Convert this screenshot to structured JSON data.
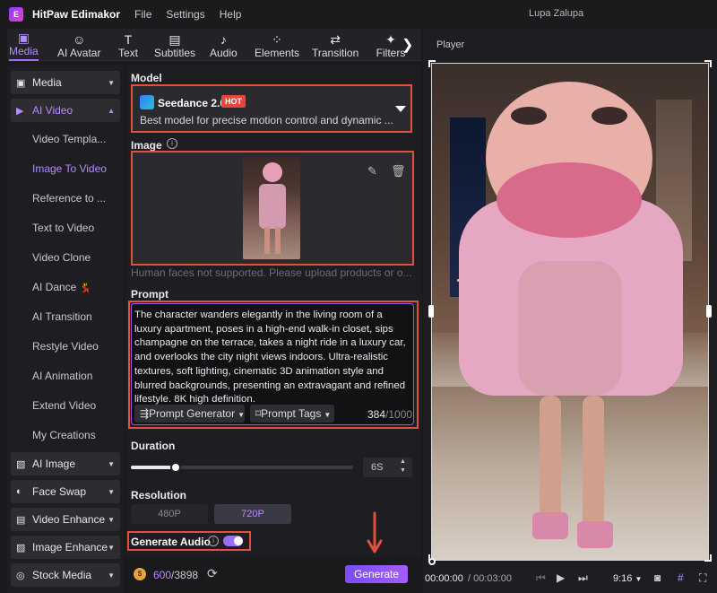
{
  "app": {
    "name": "HitPaw Edimakor",
    "logo": "E",
    "window_title": "Lupa Zalupa",
    "menu": [
      "File",
      "Settings",
      "Help"
    ]
  },
  "toolbar": {
    "tabs": [
      {
        "label": "Media",
        "icon": "media-icon",
        "glyph": "▣",
        "active": true
      },
      {
        "label": "AI Avatar",
        "icon": "ai-avatar-icon",
        "glyph": "☺"
      },
      {
        "label": "Text",
        "icon": "text-icon",
        "glyph": "T"
      },
      {
        "label": "Subtitles",
        "icon": "subtitles-icon",
        "glyph": "▤"
      },
      {
        "label": "Audio",
        "icon": "audio-icon",
        "glyph": "♪"
      },
      {
        "label": "Elements",
        "icon": "elements-icon",
        "glyph": "⁘"
      },
      {
        "label": "Transition",
        "icon": "transition-icon",
        "glyph": "⇄"
      },
      {
        "label": "Filters",
        "icon": "filters-icon",
        "glyph": "✦"
      }
    ],
    "next_glyph": "❯"
  },
  "sidebar": {
    "groups": [
      {
        "label": "Media",
        "glyph": "▣",
        "icon": "media-icon"
      },
      {
        "label": "AI Video",
        "glyph": "▶",
        "icon": "ai-video-icon",
        "active": true,
        "expanded": true
      },
      {
        "label": "AI Image",
        "glyph": "▧",
        "icon": "ai-image-icon"
      },
      {
        "label": "Face Swap",
        "glyph": "◐",
        "icon": "face-swap-icon"
      },
      {
        "label": "Video Enhance",
        "glyph": "▤",
        "icon": "video-enhance-icon"
      },
      {
        "label": "Image Enhance",
        "glyph": "▨",
        "icon": "image-enhance-icon"
      },
      {
        "label": "Stock Media",
        "glyph": "◎",
        "icon": "stock-media-icon"
      }
    ],
    "ai_video_items": [
      "Video Templa...",
      "Image To Video",
      "Reference to ...",
      "Text to Video",
      "Video Clone",
      "AI Dance",
      "AI Transition",
      "Restyle Video",
      "AI Animation",
      "Extend Video",
      "My Creations"
    ],
    "active_item": "Image To Video",
    "ai_dance_emoji": "💃"
  },
  "model": {
    "section_label": "Model",
    "name": "Seedance 2.0",
    "badge": "HOT",
    "description": "Best model for precise motion control and dynamic ..."
  },
  "image": {
    "section_label": "Image",
    "info_glyph": "i",
    "edit_glyph": "✎",
    "delete_glyph": "🗑",
    "hint": "Human faces not supported. Please upload products or o..."
  },
  "prompt": {
    "section_label": "Prompt",
    "text": "The character wanders elegantly in the living room of a luxury apartment, poses in a high-end walk-in closet, sips champagne on the terrace, takes a night ride in a luxury car, and overlooks the city night views indoors. Ultra-realistic textures, soft lighting, cinematic 3D animation style and blurred backgrounds, presenting an extravagant and refined lifestyle. 8K high definition.",
    "generator_label": "Prompt Generator",
    "tags_label": "Prompt Tags",
    "char_count": "384",
    "char_max": "/1000"
  },
  "duration": {
    "section_label": "Duration",
    "value": "6S",
    "slider_fraction": 0.2
  },
  "resolution": {
    "section_label": "Resolution",
    "options": [
      "480P",
      "720P"
    ],
    "selected": "720P"
  },
  "generate_audio": {
    "label": "Generate Audio",
    "enabled": true
  },
  "footer": {
    "credits_used": "600",
    "credits_total": "/3898",
    "generate_label": "Generate"
  },
  "player": {
    "header": "Player",
    "time_current": "00:00:00",
    "time_total": "/ 00:03:00",
    "aspect_ratio": "9:16"
  },
  "colors": {
    "accent": "#a070ff",
    "highlight_box": "#e0503c",
    "hot_badge": "#e8453c"
  }
}
